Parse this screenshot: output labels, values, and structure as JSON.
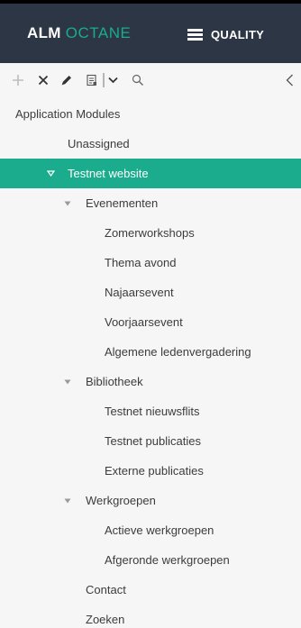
{
  "header": {
    "brand_primary": "ALM",
    "brand_secondary": "OCTANE",
    "module_label": "QUALITY",
    "colors": {
      "bar": "#2c3645",
      "accent": "#1aac8c"
    }
  },
  "toolbar": {
    "buttons": [
      {
        "icon": "plus-icon",
        "enabled": false
      },
      {
        "icon": "close-icon",
        "enabled": true
      },
      {
        "icon": "pencil-icon",
        "enabled": true
      },
      {
        "icon": "report-icon",
        "enabled": true
      },
      {
        "icon": "chevron-down-icon",
        "enabled": true
      },
      {
        "icon": "search-icon",
        "enabled": true
      },
      {
        "icon": "collapse-left-icon",
        "enabled": true
      }
    ]
  },
  "tree": {
    "root_label": "Application Modules",
    "nodes": [
      {
        "label": "Unassigned",
        "level": 1,
        "expander": "none",
        "selected": false
      },
      {
        "label": "Testnet website",
        "level": 1,
        "expander": "expanded",
        "selected": true
      },
      {
        "label": "Evenementen",
        "level": 2,
        "expander": "expanded",
        "selected": false
      },
      {
        "label": "Zomerworkshops",
        "level": 3,
        "expander": "none",
        "selected": false
      },
      {
        "label": "Thema avond",
        "level": 3,
        "expander": "none",
        "selected": false
      },
      {
        "label": "Najaarsevent",
        "level": 3,
        "expander": "none",
        "selected": false
      },
      {
        "label": "Voorjaarsevent",
        "level": 3,
        "expander": "none",
        "selected": false
      },
      {
        "label": "Algemene ledenvergadering",
        "level": 3,
        "expander": "none",
        "selected": false
      },
      {
        "label": "Bibliotheek",
        "level": 2,
        "expander": "expanded",
        "selected": false
      },
      {
        "label": "Testnet nieuwsflits",
        "level": 3,
        "expander": "none",
        "selected": false
      },
      {
        "label": "Testnet publicaties",
        "level": 3,
        "expander": "none",
        "selected": false
      },
      {
        "label": "Externe publicaties",
        "level": 3,
        "expander": "none",
        "selected": false
      },
      {
        "label": "Werkgroepen",
        "level": 2,
        "expander": "expanded",
        "selected": false
      },
      {
        "label": "Actieve werkgroepen",
        "level": 3,
        "expander": "none",
        "selected": false
      },
      {
        "label": "Afgeronde werkgroepen",
        "level": 3,
        "expander": "none",
        "selected": false
      },
      {
        "label": "Contact",
        "level": 2,
        "expander": "none",
        "selected": false
      },
      {
        "label": "Zoeken",
        "level": 2,
        "expander": "none",
        "selected": false
      }
    ]
  }
}
